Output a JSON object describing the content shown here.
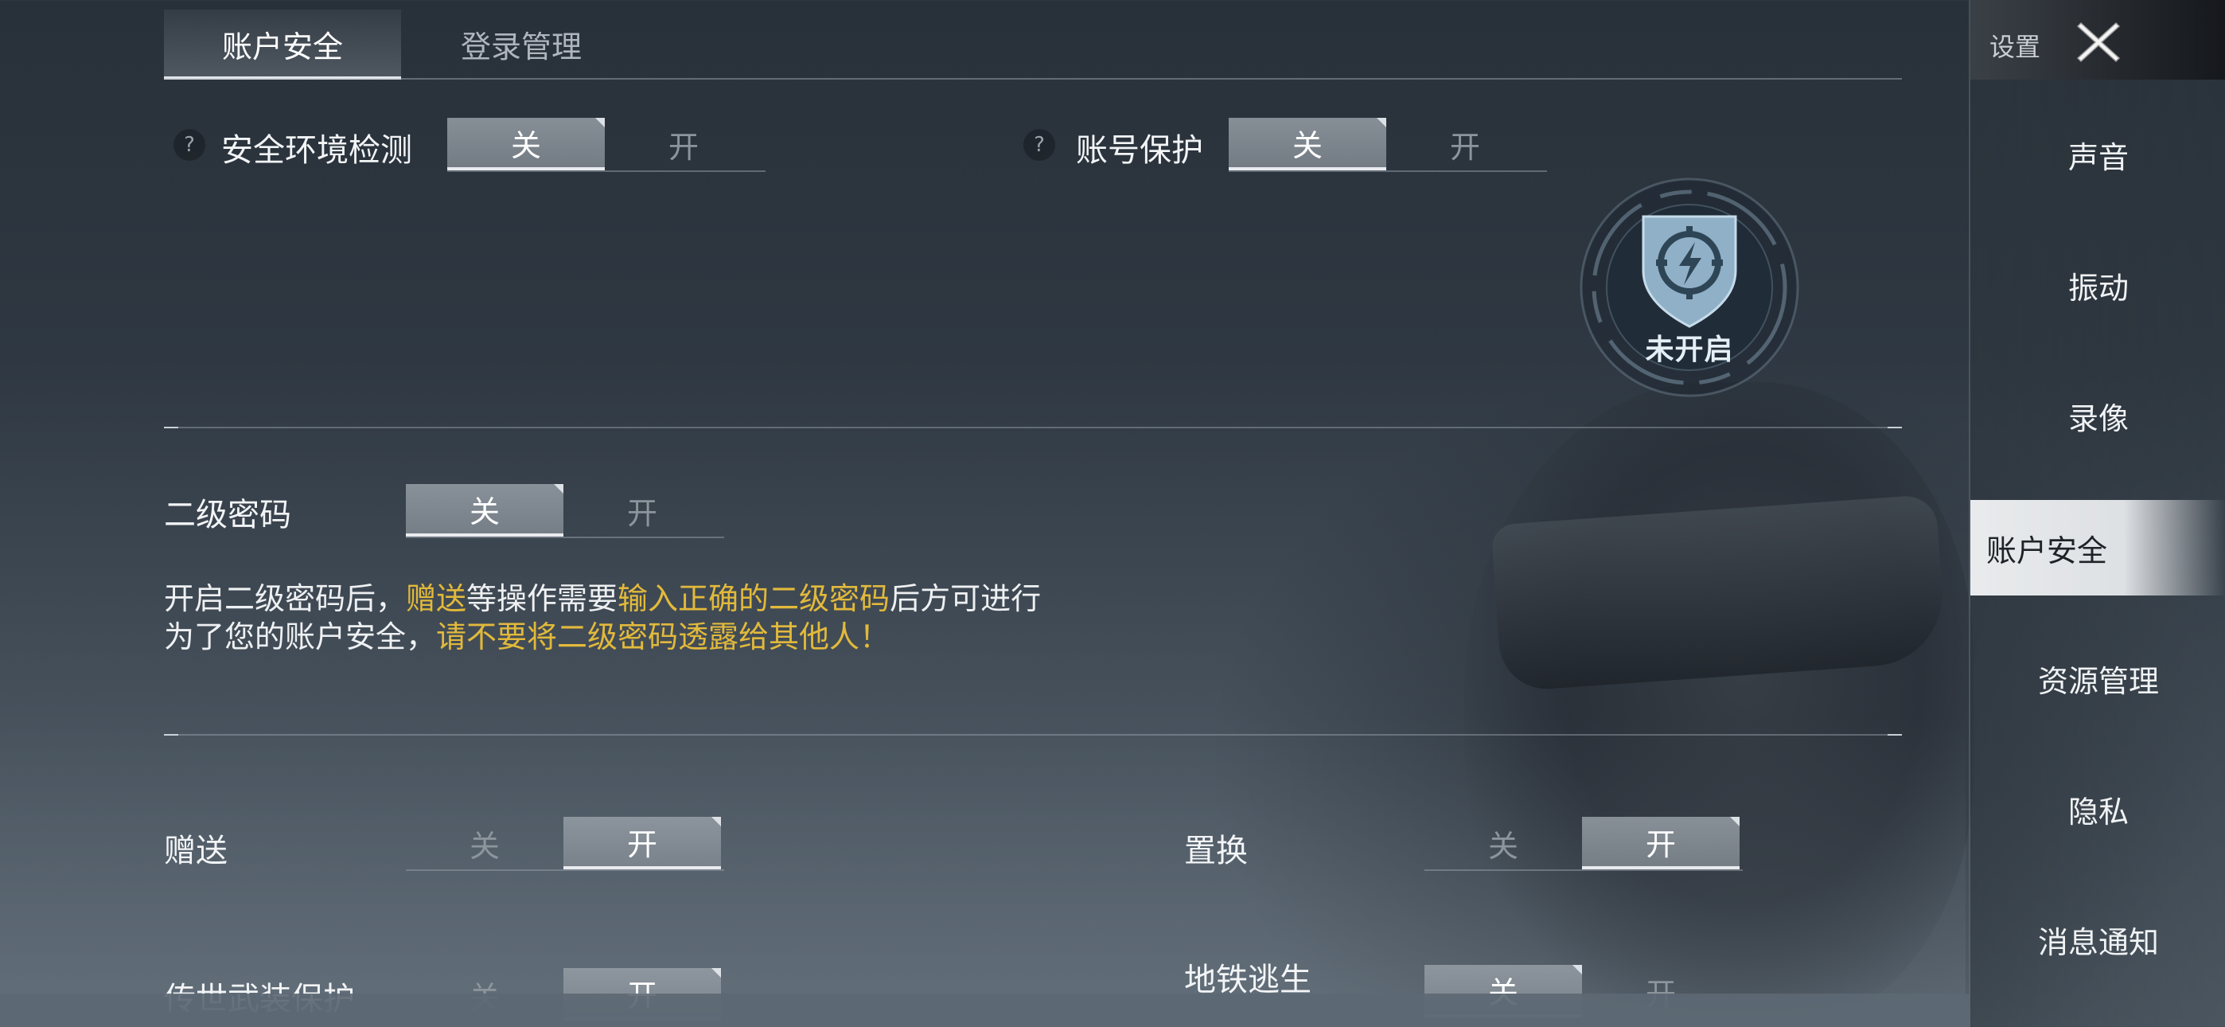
{
  "sidebar": {
    "title": "设置",
    "items": [
      {
        "label": "声音"
      },
      {
        "label": "振动"
      },
      {
        "label": "录像"
      },
      {
        "label": "账户安全"
      },
      {
        "label": "资源管理"
      },
      {
        "label": "隐私"
      },
      {
        "label": "消息通知"
      }
    ],
    "active_index": 3
  },
  "tabs": [
    {
      "label": "账户安全",
      "active": true
    },
    {
      "label": "登录管理",
      "active": false
    }
  ],
  "icons": {
    "help": "?",
    "close": "close-icon"
  },
  "toggle_labels": {
    "off": "关",
    "on": "开"
  },
  "security_env": {
    "label": "安全环境检测",
    "state": "关"
  },
  "account_protect": {
    "label": "账号保护",
    "state": "关"
  },
  "badge": {
    "text": "未开启"
  },
  "second_password": {
    "label": "二级密码",
    "state": "关",
    "desc_line1": [
      "开启二级密码后，",
      "赠送",
      "等操作需要",
      "输入正确的二级密码",
      "后方可进行"
    ],
    "desc_line2": [
      "为了您的账户安全，",
      "请不要将二级密码透露给其他人！"
    ]
  },
  "gift": {
    "label": "赠送",
    "state": "开"
  },
  "swap": {
    "label": "置换",
    "state": "开"
  },
  "legend_protect": {
    "label": "传世武装保护",
    "state": "开"
  },
  "metro": {
    "label": "地铁逃生",
    "state": "关"
  },
  "colors": {
    "highlight": "#e2b93b",
    "active_nav_bg": "#f0f2f4"
  }
}
